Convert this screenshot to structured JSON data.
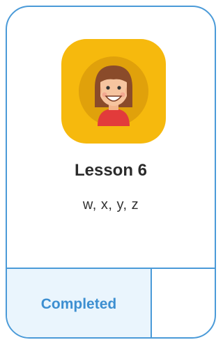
{
  "lesson": {
    "title": "Lesson 6",
    "letters": "w, x, y, z",
    "avatar_icon": "girl-avatar-icon"
  },
  "footer": {
    "status_label": "Completed"
  },
  "colors": {
    "border": "#4a9ad8",
    "accent_text": "#3d8fd1",
    "status_background": "#eaf5fd",
    "avatar_background": "#f6b90d"
  }
}
